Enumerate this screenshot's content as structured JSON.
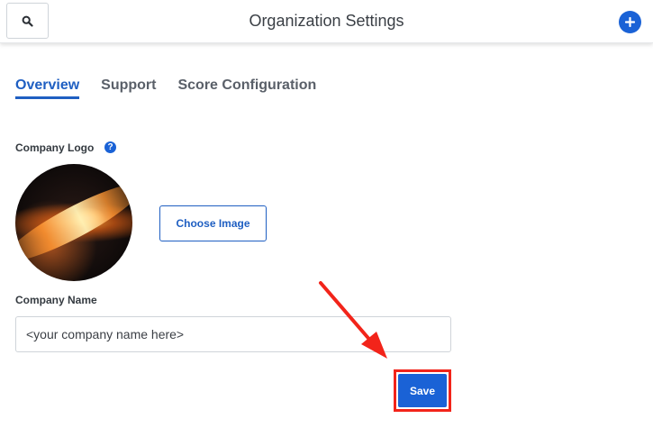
{
  "header": {
    "title": "Organization Settings",
    "search_icon": "search-icon",
    "add_icon": "plus-icon"
  },
  "tabs": [
    {
      "label": "Overview",
      "active": true
    },
    {
      "label": "Support",
      "active": false
    },
    {
      "label": "Score Configuration",
      "active": false
    }
  ],
  "logo_section": {
    "label": "Company Logo",
    "help_icon": "question-icon",
    "help_glyph": "?",
    "choose_button": "Choose Image"
  },
  "name_section": {
    "label": "Company Name",
    "value": "<your company name here>"
  },
  "save_button": "Save",
  "annotation": {
    "type": "arrow-and-highlight",
    "color": "#f2241a"
  },
  "colors": {
    "accent": "#1a62d6",
    "tab_active": "#1f5fc2",
    "highlight": "#f2241a"
  }
}
